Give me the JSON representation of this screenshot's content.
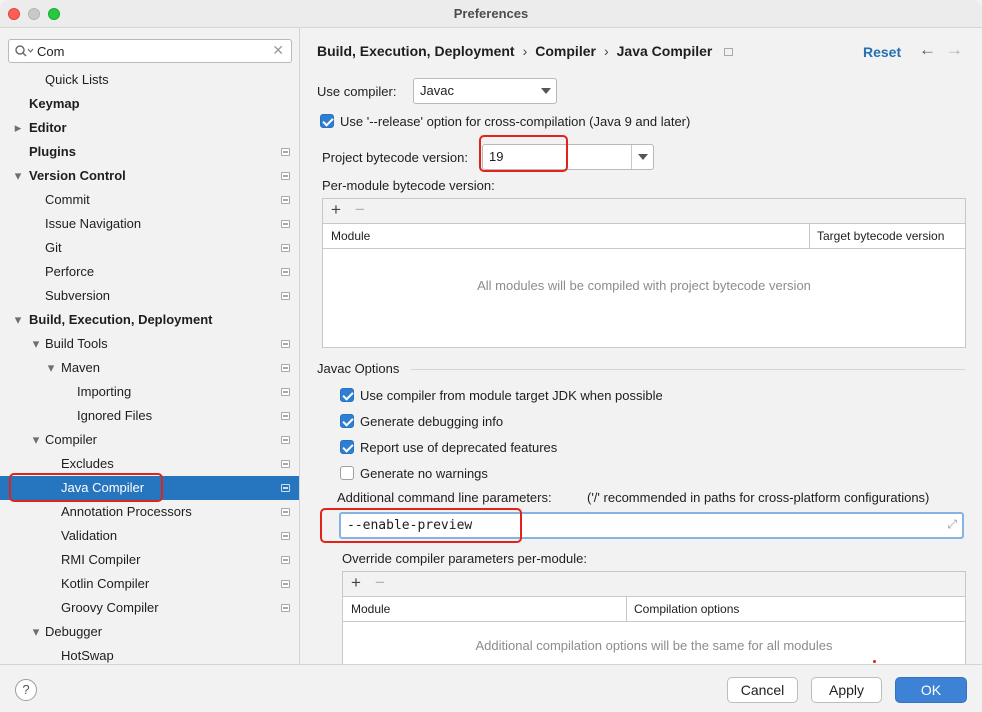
{
  "window": {
    "title": "Preferences"
  },
  "search": {
    "value": "Com"
  },
  "tree": [
    {
      "label": "Quick Lists",
      "level": 1,
      "bold": false,
      "arrow": "",
      "proj": false,
      "selected": false
    },
    {
      "label": "Keymap",
      "level": 0,
      "bold": true,
      "arrow": "",
      "proj": false,
      "selected": false
    },
    {
      "label": "Editor",
      "level": 0,
      "bold": true,
      "arrow": "right",
      "proj": false,
      "selected": false
    },
    {
      "label": "Plugins",
      "level": 0,
      "bold": true,
      "arrow": "",
      "proj": true,
      "selected": false
    },
    {
      "label": "Version Control",
      "level": 0,
      "bold": true,
      "arrow": "down",
      "proj": true,
      "selected": false
    },
    {
      "label": "Commit",
      "level": 1,
      "bold": false,
      "arrow": "",
      "proj": true,
      "selected": false
    },
    {
      "label": "Issue Navigation",
      "level": 1,
      "bold": false,
      "arrow": "",
      "proj": true,
      "selected": false
    },
    {
      "label": "Git",
      "level": 1,
      "bold": false,
      "arrow": "",
      "proj": true,
      "selected": false
    },
    {
      "label": "Perforce",
      "level": 1,
      "bold": false,
      "arrow": "",
      "proj": true,
      "selected": false
    },
    {
      "label": "Subversion",
      "level": 1,
      "bold": false,
      "arrow": "",
      "proj": true,
      "selected": false
    },
    {
      "label": "Build, Execution, Deployment",
      "level": 0,
      "bold": true,
      "arrow": "down",
      "proj": false,
      "selected": false
    },
    {
      "label": "Build Tools",
      "level": 1,
      "bold": false,
      "arrow": "down",
      "proj": true,
      "selected": false
    },
    {
      "label": "Maven",
      "level": 2,
      "bold": false,
      "arrow": "down",
      "proj": true,
      "selected": false
    },
    {
      "label": "Importing",
      "level": 3,
      "bold": false,
      "arrow": "",
      "proj": true,
      "selected": false
    },
    {
      "label": "Ignored Files",
      "level": 3,
      "bold": false,
      "arrow": "",
      "proj": true,
      "selected": false
    },
    {
      "label": "Compiler",
      "level": 1,
      "bold": false,
      "arrow": "down",
      "proj": true,
      "selected": false
    },
    {
      "label": "Excludes",
      "level": 2,
      "bold": false,
      "arrow": "",
      "proj": true,
      "selected": false
    },
    {
      "label": "Java Compiler",
      "level": 2,
      "bold": false,
      "arrow": "",
      "proj": true,
      "selected": true
    },
    {
      "label": "Annotation Processors",
      "level": 2,
      "bold": false,
      "arrow": "",
      "proj": true,
      "selected": false
    },
    {
      "label": "Validation",
      "level": 2,
      "bold": false,
      "arrow": "",
      "proj": true,
      "selected": false
    },
    {
      "label": "RMI Compiler",
      "level": 2,
      "bold": false,
      "arrow": "",
      "proj": true,
      "selected": false
    },
    {
      "label": "Kotlin Compiler",
      "level": 2,
      "bold": false,
      "arrow": "",
      "proj": true,
      "selected": false
    },
    {
      "label": "Groovy Compiler",
      "level": 2,
      "bold": false,
      "arrow": "",
      "proj": true,
      "selected": false
    },
    {
      "label": "Debugger",
      "level": 1,
      "bold": false,
      "arrow": "down",
      "proj": false,
      "selected": false
    },
    {
      "label": "HotSwap",
      "level": 2,
      "bold": false,
      "arrow": "",
      "proj": false,
      "selected": false
    }
  ],
  "breadcrumb": {
    "part1": "Build, Execution, Deployment",
    "part2": "Compiler",
    "part3": "Java Compiler",
    "separator": "›"
  },
  "header": {
    "reset_label": "Reset",
    "back_icon": "←",
    "forward_icon": "→"
  },
  "use_compiler": {
    "label": "Use compiler:",
    "value": "Javac"
  },
  "release_option": {
    "label": "Use '--release' option for cross-compilation (Java 9 and later)",
    "checked": true
  },
  "bytecode": {
    "label": "Project bytecode version:",
    "value": "19"
  },
  "per_module": {
    "label": "Per-module bytecode version:",
    "add_icon": "+",
    "remove_icon": "−",
    "columns": [
      "Module",
      "Target bytecode version"
    ],
    "empty_text": "All modules will be compiled with project bytecode version"
  },
  "javac_options": {
    "title": "Javac Options",
    "checkboxes": [
      {
        "label": "Use compiler from module target JDK when possible",
        "checked": true
      },
      {
        "label": "Generate debugging info",
        "checked": true
      },
      {
        "label": "Report use of deprecated features",
        "checked": true
      },
      {
        "label": "Generate no warnings",
        "checked": false
      }
    ],
    "additional_label": "Additional command line parameters:",
    "additional_hint": "('/' recommended in paths for cross-platform configurations)",
    "additional_value": "--enable-preview",
    "override_label": "Override compiler parameters per-module:",
    "override_columns": [
      "Module",
      "Compilation options"
    ],
    "override_empty": "Additional compilation options will be the same for all modules",
    "add_icon": "+",
    "remove_icon": "−"
  },
  "footer": {
    "help_label": "?",
    "cancel_label": "Cancel",
    "apply_label": "Apply",
    "ok_label": "OK"
  },
  "colors": {
    "selection": "#2675bf",
    "accent": "#2e7fd4",
    "highlight": "#e0241b",
    "link": "#2470b3"
  }
}
